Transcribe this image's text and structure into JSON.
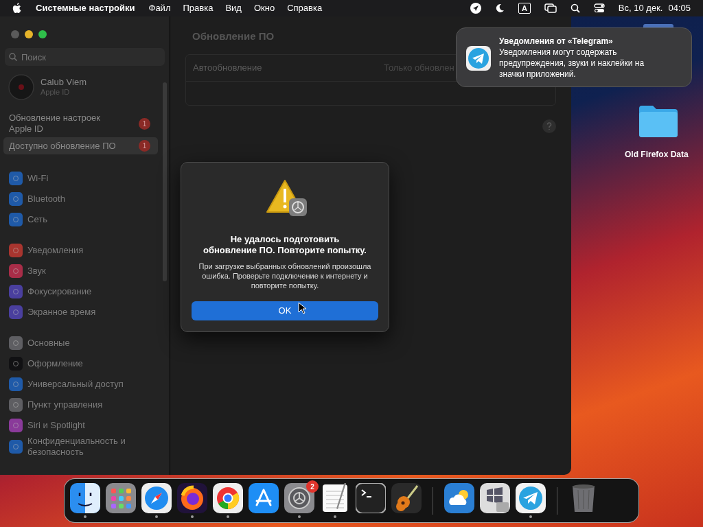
{
  "menubar": {
    "app_name": "Системные настройки",
    "menus": [
      "Файл",
      "Правка",
      "Вид",
      "Окно",
      "Справка"
    ],
    "input_source": "A",
    "date": "Вс, 10 дек.",
    "time": "04:05"
  },
  "sidebar": {
    "search_placeholder": "Поиск",
    "account": {
      "name": "Calub Viem",
      "subtitle": "Apple ID"
    },
    "alerts": [
      {
        "label": "Обновление настроек Apple ID",
        "badge": "1",
        "selected": false
      },
      {
        "label": "Доступно обновление ПО",
        "badge": "1",
        "selected": true
      }
    ],
    "groups": [
      [
        {
          "label": "Wi-Fi",
          "color": "#1f5aa8"
        },
        {
          "label": "Bluetooth",
          "color": "#1f5aa8"
        },
        {
          "label": "Сеть",
          "color": "#1f5aa8"
        }
      ],
      [
        {
          "label": "Уведомления",
          "color": "#a8352f"
        },
        {
          "label": "Звук",
          "color": "#a82d48"
        },
        {
          "label": "Фокусирование",
          "color": "#4a3f9e"
        },
        {
          "label": "Экранное время",
          "color": "#4a3f9e"
        }
      ],
      [
        {
          "label": "Основные",
          "color": "#5e5e62"
        },
        {
          "label": "Оформление",
          "color": "#111113"
        },
        {
          "label": "Универсальный доступ",
          "color": "#1f5aa8"
        },
        {
          "label": "Пункт управления",
          "color": "#5e5e62"
        },
        {
          "label": "Siri и Spotlight",
          "color": "#8a3a9a"
        },
        {
          "label": "Конфиденциальность и безопасность",
          "color": "#1f5aa8"
        }
      ]
    ]
  },
  "content": {
    "title": "Обновление ПО",
    "rows": [
      {
        "label": "Автообновление",
        "value": "Только обновлен"
      }
    ]
  },
  "dialog": {
    "title": "Не удалось подготовить обновление ПО. Повторите попытку.",
    "message": "При загрузке выбранных обновлений произошла ошибка. Проверьте подключение к интернету и повторите попытку.",
    "button": "OK"
  },
  "notification": {
    "title": "Уведомления от «Telegram»",
    "body": "Уведомления могут содержать предупреждения, звуки и наклейки на значки приложений."
  },
  "desktop": {
    "folder_label": "Old Firefox Data"
  },
  "dock": [
    {
      "kind": "finder",
      "running": true
    },
    {
      "kind": "launchpad",
      "running": false
    },
    {
      "kind": "safari",
      "running": true
    },
    {
      "kind": "firefox",
      "running": true
    },
    {
      "kind": "chrome",
      "running": true
    },
    {
      "kind": "appstore",
      "running": false
    },
    {
      "kind": "settings",
      "running": true,
      "badge": "2"
    },
    {
      "kind": "textedit",
      "running": true
    },
    {
      "kind": "terminal",
      "running": false
    },
    {
      "kind": "garageband",
      "running": false
    },
    {
      "kind": "separator"
    },
    {
      "kind": "weather",
      "running": false
    },
    {
      "kind": "assistant",
      "running": false
    },
    {
      "kind": "telegram",
      "running": true
    },
    {
      "kind": "separator"
    },
    {
      "kind": "trash",
      "running": false
    }
  ]
}
